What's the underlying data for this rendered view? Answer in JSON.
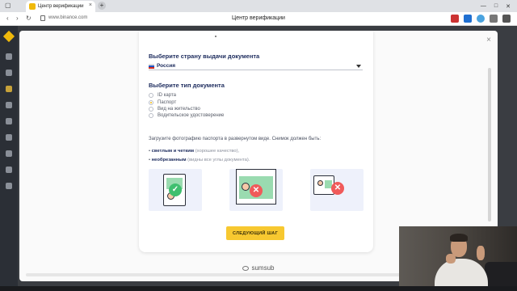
{
  "browser": {
    "tab_title": "Центр верификации",
    "tab_close": "×",
    "new_tab": "+",
    "url": "www.binance.com",
    "page_title": "Центр верификации",
    "win_min": "—",
    "win_max": "□",
    "win_close": "✕",
    "back": "‹",
    "forward": "›",
    "reload": "↻"
  },
  "modal": {
    "close": "×",
    "country_section": {
      "title": "Выберите страну выдачи документа",
      "selected": "Россия",
      "flag_colors": [
        "#ffffff",
        "#1c57c8",
        "#d52b1e"
      ]
    },
    "doc_type_section": {
      "title": "Выберите тип документа",
      "options": [
        {
          "label": "ID карта",
          "selected": false
        },
        {
          "label": "Паспорт",
          "selected": true
        },
        {
          "label": "Вид на жительство",
          "selected": false
        },
        {
          "label": "Водительское удостоверение",
          "selected": false
        }
      ]
    },
    "upload": {
      "description": "Загрузите фотографию паспорта в развернутом виде. Снимок должен быть:",
      "bullets": [
        {
          "strong": "светлым и четким",
          "muted": "(хорошее качество),"
        },
        {
          "strong": "необрезанным",
          "muted": "(видны все углы документа)."
        }
      ],
      "examples": [
        {
          "status": "ok",
          "icon": "check-icon"
        },
        {
          "status": "bad",
          "icon": "cross-icon"
        },
        {
          "status": "bad",
          "icon": "cross-icon"
        }
      ],
      "ok_glyph": "✓",
      "bad_glyph": "✕"
    },
    "next_button": "СЛЕДУЮЩИЙ ШАГ",
    "footer_brand": "sumsub"
  },
  "colors": {
    "accent": "#f0b90b",
    "button": "#f7c830",
    "heading": "#1b2a5c"
  }
}
